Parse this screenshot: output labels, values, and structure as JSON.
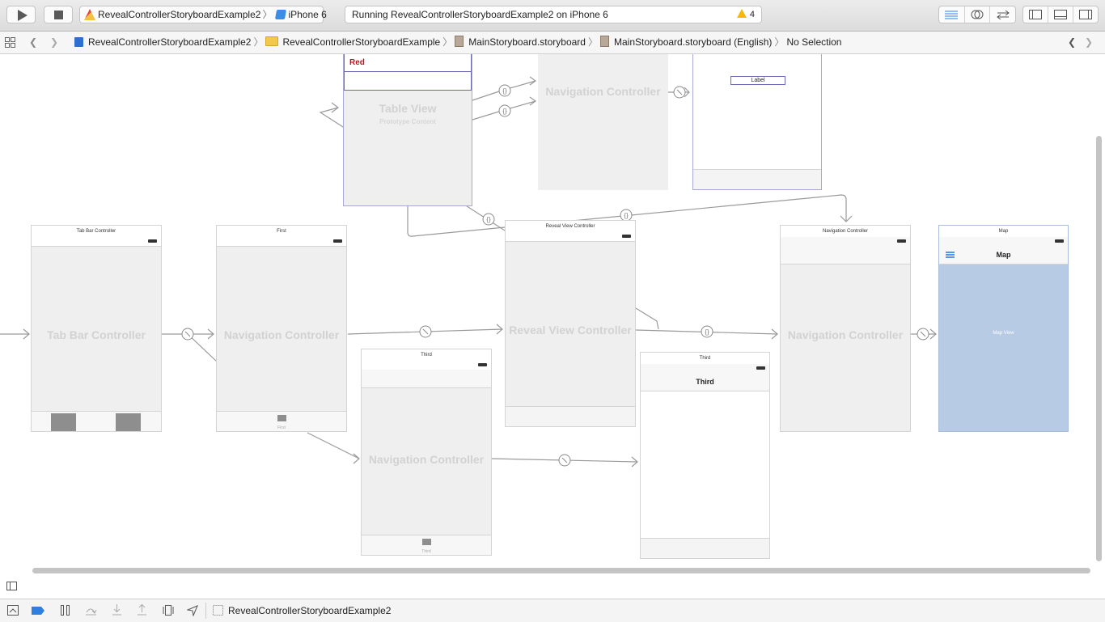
{
  "toolbar": {
    "scheme_name": "RevealControllerStoryboardExample2",
    "device": "iPhone 6",
    "status_text": "Running RevealControllerStoryboardExample2 on iPhone 6",
    "warning_count": "4"
  },
  "jumpbar": {
    "crumbs": [
      "RevealControllerStoryboardExample2",
      "RevealControllerStoryboardExample",
      "MainStoryboard.storyboard",
      "MainStoryboard.storyboard (English)",
      "No Selection"
    ]
  },
  "canvas": {
    "table_cell_label": "Red",
    "table_view_title": "Table View",
    "table_view_subtitle": "Prototype Content",
    "top_nav_title": "Navigation Controller",
    "top_label": "Label",
    "scenes": {
      "tab_bar": {
        "header": "Tab Bar Controller",
        "title": "Tab Bar Controller"
      },
      "first_nav": {
        "header": "First",
        "title": "Navigation Controller",
        "tab_label": "First"
      },
      "reveal": {
        "header": "Reveal View Controller",
        "title": "Reveal View Controller"
      },
      "third_nav": {
        "header": "Third",
        "title": "Navigation Controller",
        "tab_label": "Third"
      },
      "third_view": {
        "header": "Third",
        "nav_title": "Third"
      },
      "right_nav": {
        "header": "Navigation Controller",
        "title": "Navigation Controller"
      },
      "map": {
        "header": "Map",
        "nav_title": "Map",
        "body": "Map View"
      }
    }
  },
  "bottombar": {
    "target_name": "RevealControllerStoryboardExample2"
  },
  "colors": {
    "map_view_fill": "#b7cbe5",
    "accent_blue": "#2f7fe0",
    "warning": "#f5b90d",
    "red_label": "#c0121d"
  }
}
